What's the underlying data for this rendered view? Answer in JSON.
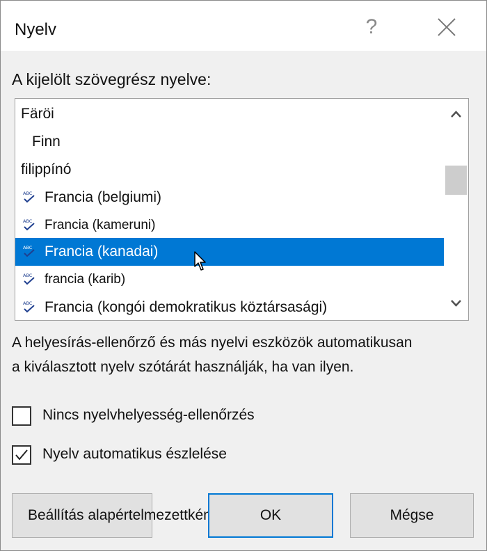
{
  "dialog": {
    "title": "Nyelv",
    "help_label": "?"
  },
  "language_section": {
    "label": "A kijelölt szövegrész nyelve:",
    "items": [
      {
        "label": "Färöi",
        "has_spellcheck": false,
        "indent": false,
        "selected": false
      },
      {
        "label": "Finn",
        "has_spellcheck": false,
        "indent": true,
        "selected": false
      },
      {
        "label": "filippínó",
        "has_spellcheck": false,
        "indent": false,
        "selected": false
      },
      {
        "label": "Francia (belgiumi)",
        "has_spellcheck": true,
        "indent": false,
        "selected": false
      },
      {
        "label": "Francia (kameruni)",
        "has_spellcheck": true,
        "indent": false,
        "selected": false
      },
      {
        "label": "Francia (kanadai)",
        "has_spellcheck": true,
        "indent": false,
        "selected": true
      },
      {
        "label": "francia (karib)",
        "has_spellcheck": true,
        "indent": false,
        "selected": false
      },
      {
        "label": "Francia (kongói demokratikus köztársasági)",
        "has_spellcheck": true,
        "indent": false,
        "selected": false
      }
    ]
  },
  "description": {
    "line1": "A helyesírás-ellenőrző és más nyelvi eszközök automatikusan",
    "line2": "a kiválasztott nyelv szótárát használják, ha van ilyen."
  },
  "options": {
    "no_proofing": {
      "label": "Nincs nyelvhelyesség-ellenőrzés",
      "checked": false
    },
    "detect_language": {
      "label": "Nyelv automatikus észlelése",
      "checked": true
    }
  },
  "buttons": {
    "set_default": "Beállítás alapértelmezettként",
    "ok": "OK",
    "cancel": "Mégse"
  },
  "colors": {
    "selection": "#0078d4",
    "spellcheck_icon": "#1f3f8f"
  }
}
